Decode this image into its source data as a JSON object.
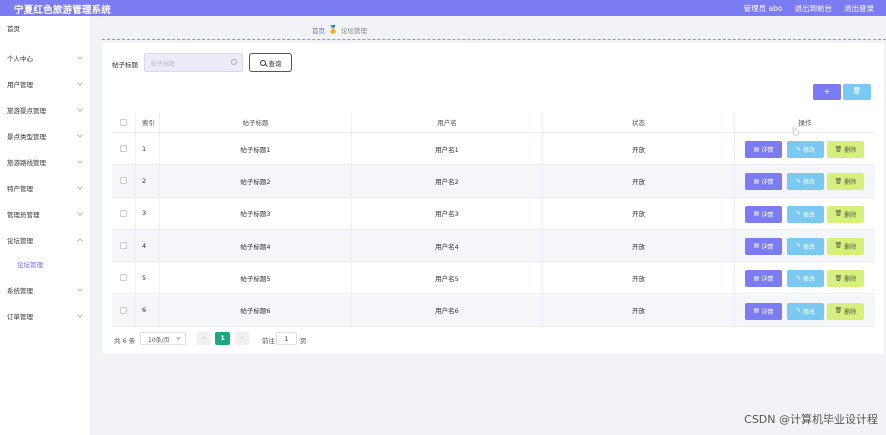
{
  "header": {
    "title": "宁夏红色旅游管理系统",
    "user": "管理员 abo",
    "back_link": "退出到前台",
    "logout": "退出登录"
  },
  "sidebar": {
    "items": [
      {
        "label": "首页",
        "chevron": false
      },
      {
        "label": "个人中心",
        "chevron": true
      },
      {
        "label": "用户管理",
        "chevron": true
      },
      {
        "label": "旅游景点管理",
        "chevron": true
      },
      {
        "label": "景点类型管理",
        "chevron": true
      },
      {
        "label": "旅游路线管理",
        "chevron": true
      },
      {
        "label": "特产管理",
        "chevron": true
      },
      {
        "label": "管理员管理",
        "chevron": true
      },
      {
        "label": "论坛管理",
        "chevron": true
      },
      {
        "label": "系统管理",
        "chevron": true
      },
      {
        "label": "订单管理",
        "chevron": true
      }
    ],
    "subitem": {
      "label": "论坛管理",
      "active_color": "#6f6fe8"
    }
  },
  "breadcrumb": {
    "home": "首页",
    "separator": "🏅",
    "current": "论坛管理"
  },
  "search": {
    "label": "帖子标题",
    "placeholder": "帖子标题",
    "button_label": "查询"
  },
  "toolbar": {
    "add_label": "+",
    "delete_label": "🗑"
  },
  "table": {
    "columns": [
      "索引",
      "帖子标题",
      "用户名",
      "状态",
      "操作"
    ],
    "rows": [
      {
        "index": "1",
        "title": "帖子标题1",
        "username": "用户名1",
        "status": "开放"
      },
      {
        "index": "2",
        "title": "帖子标题2",
        "username": "用户名2",
        "status": "开放"
      },
      {
        "index": "3",
        "title": "帖子标题3",
        "username": "用户名3",
        "status": "开放"
      },
      {
        "index": "4",
        "title": "帖子标题4",
        "username": "用户名4",
        "status": "开放"
      },
      {
        "index": "5",
        "title": "帖子标题5",
        "username": "用户名5",
        "status": "开放"
      },
      {
        "index": "6",
        "title": "帖子标题6",
        "username": "用户名6",
        "status": "开放"
      }
    ],
    "actions": {
      "detail": "详情",
      "edit": "修改",
      "delete": "删除"
    }
  },
  "pagination": {
    "total": "共 6 条",
    "page_size": "10条/页",
    "current_page": "1",
    "goto_label": "前往",
    "goto_value": "1",
    "page_suffix": "页"
  },
  "watermark": "CSDN @计算机毕业设计程",
  "colors": {
    "accent": "#7b7cf2",
    "info": "#79c9f0",
    "lime": "#d6f07c",
    "pager_active": "#19a882"
  }
}
